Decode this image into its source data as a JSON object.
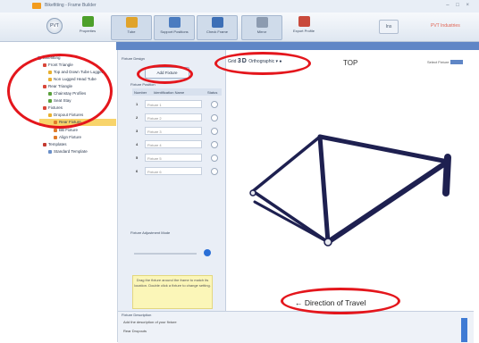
{
  "window": {
    "title": "Bikefitting - Frame Builder",
    "controls": "– □ ×"
  },
  "ribbon": {
    "app_button": "PVT",
    "buttons": [
      {
        "label": "Properties",
        "icon": "properties-icon",
        "color": "#4da02a"
      },
      {
        "label": "Tube",
        "icon": "tube-icon",
        "color": "#e0a32a"
      },
      {
        "label": "Support Positions",
        "icon": "support-positions-icon",
        "color": "#4b7cc0"
      },
      {
        "label": "Check Frame",
        "icon": "check-frame-icon",
        "color": "#3d6fb6"
      },
      {
        "label": "Mirror",
        "icon": "mirror-icon",
        "color": "#8c9bb0"
      },
      {
        "label": "Export Profile",
        "icon": "export-profile-icon",
        "color": "#c94a3c"
      }
    ],
    "extra_button": "Ins",
    "brand": "PVT Industries"
  },
  "tree": {
    "items": [
      {
        "label": "Bikefitting",
        "level": 0
      },
      {
        "label": "Front Triangle",
        "level": 1
      },
      {
        "label": "Top and Down Tube Lugged",
        "level": 2
      },
      {
        "label": "Non Lugged Head Tube",
        "level": 2
      },
      {
        "label": "Rear Triangle",
        "level": 1
      },
      {
        "label": "Chainstay Profiles",
        "level": 2
      },
      {
        "label": "Seat Stay",
        "level": 2
      },
      {
        "label": "Fixtures",
        "level": 1
      },
      {
        "label": "Dropout Fixtures",
        "level": 2
      },
      {
        "label": "Rear Fixture",
        "level": 3
      },
      {
        "label": "BB Fixture",
        "level": 3
      },
      {
        "label": "Align Fixture",
        "level": 3
      },
      {
        "label": "Templates",
        "level": 1
      },
      {
        "label": "Standard Template",
        "level": 2
      }
    ],
    "selected_index": 9
  },
  "panel": {
    "header": "Fixture Design",
    "create_button": "Add Fixture",
    "table": {
      "section": "Fixture Position",
      "columns": [
        "Number",
        "Identification Name",
        "Status"
      ]
    },
    "rows": [
      {
        "num": "1",
        "placeholder": "Fixture 1"
      },
      {
        "num": "2",
        "placeholder": "Fixture 2"
      },
      {
        "num": "3",
        "placeholder": "Fixture 3"
      },
      {
        "num": "4",
        "placeholder": "Fixture 4"
      },
      {
        "num": "5",
        "placeholder": "Fixture 5"
      },
      {
        "num": "6",
        "placeholder": "Fixture 6"
      }
    ],
    "mark_label": "Fixture Adjustment Mode",
    "note": "Drag the fixture around the frame to match its location. Double click a fixture to change setting."
  },
  "viewport": {
    "toolbar_text": "Grid",
    "toolbar_big": "3D",
    "toolbar_tail": "Orthographic",
    "view_name": "TOP",
    "right_text": "Select Fixture",
    "direction_arrow": "←",
    "direction_label": "Direction of Travel",
    "frame_color": "#1e2050"
  },
  "bottom": {
    "title": "Fixture Description",
    "line1": "Add the description of your fixture",
    "line2": "Rear Dropouts"
  },
  "annotation_color": "#e4161c"
}
